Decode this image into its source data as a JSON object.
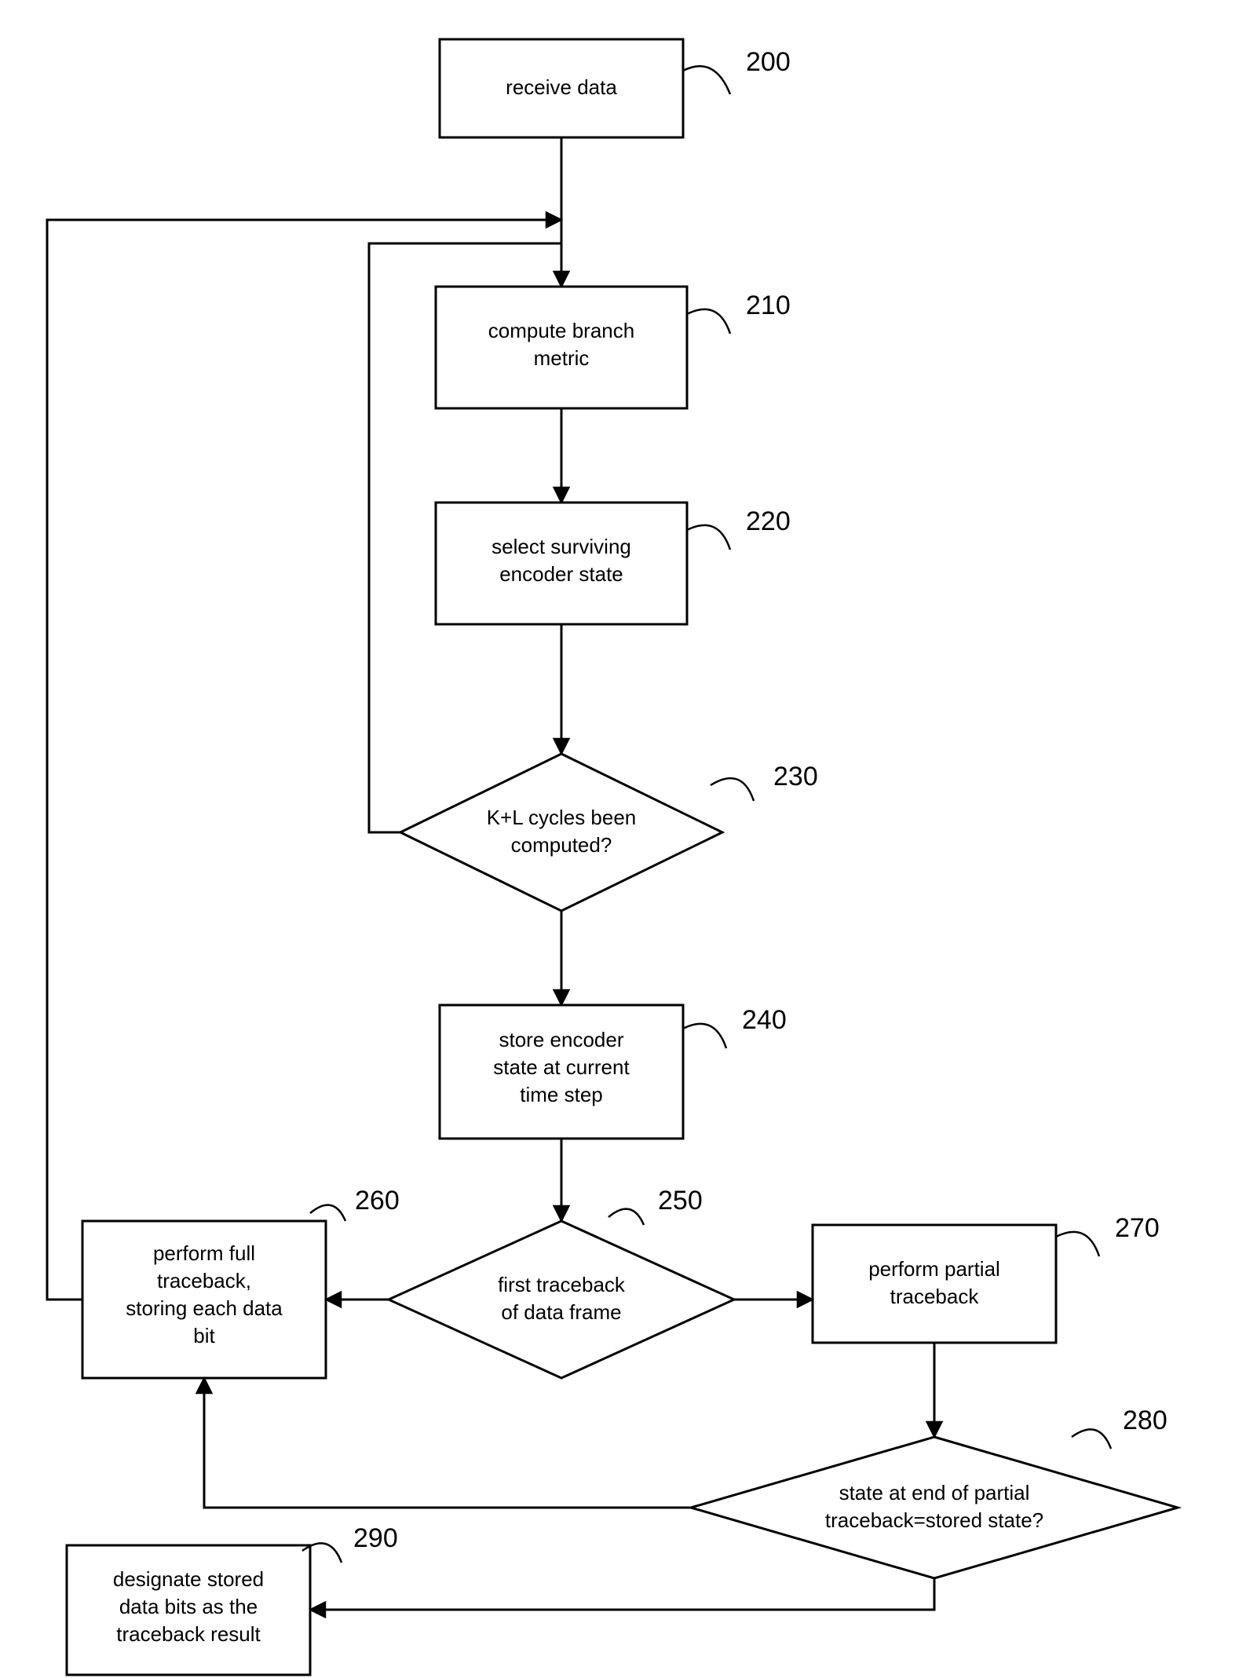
{
  "nodes": {
    "n200": {
      "label_l1": "receive data",
      "ref": "200"
    },
    "n210": {
      "label_l1": "compute branch",
      "label_l2": "metric",
      "ref": "210"
    },
    "n220": {
      "label_l1": "select surviving",
      "label_l2": "encoder state",
      "ref": "220"
    },
    "n230": {
      "label_l1": "K+L cycles been",
      "label_l2": "computed?",
      "ref": "230"
    },
    "n240": {
      "label_l1": "store encoder",
      "label_l2": "state at current",
      "label_l3": "time step",
      "ref": "240"
    },
    "n250": {
      "label_l1": "first traceback",
      "label_l2": "of data frame",
      "ref": "250"
    },
    "n260": {
      "label_l1": "perform full",
      "label_l2": "traceback,",
      "label_l3": "storing each data",
      "label_l4": "bit",
      "ref": "260"
    },
    "n270": {
      "label_l1": "perform partial",
      "label_l2": "traceback",
      "ref": "270"
    },
    "n280": {
      "label_l1": "state at end of partial",
      "label_l2": "traceback=stored  state?",
      "ref": "280"
    },
    "n290": {
      "label_l1": "designate stored",
      "label_l2": "data bits as the",
      "label_l3": "traceback result",
      "ref": "290"
    }
  }
}
